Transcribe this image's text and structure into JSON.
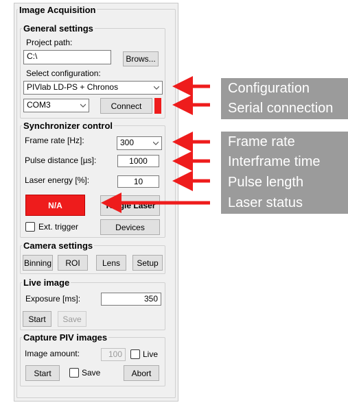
{
  "panel_title": "Image Acquisition",
  "general": {
    "title": "General settings",
    "project_path_label": "Project path:",
    "project_path_value": "C:\\",
    "browse_label": "Brows...",
    "select_config_label": "Select configuration:",
    "config_value": "PIVlab LD-PS + Chronos",
    "com_value": "COM3",
    "connect_label": "Connect"
  },
  "sync": {
    "title": "Synchronizer control",
    "frame_rate_label": "Frame rate [Hz]:",
    "frame_rate_value": "300",
    "pulse_distance_label": "Pulse distance [µs]:",
    "pulse_distance_value": "1000",
    "laser_energy_label": "Laser energy [%]:",
    "laser_energy_value": "10",
    "laser_status_value": "N/A",
    "toggle_laser_label": "Toggle Laser",
    "ext_trigger_label": "Ext. trigger",
    "devices_label": "Devices"
  },
  "camera": {
    "title": "Camera settings",
    "binning_label": "Binning",
    "roi_label": "ROI",
    "lens_label": "Lens",
    "setup_label": "Setup"
  },
  "live": {
    "title": "Live image",
    "exposure_label": "Exposure [ms]:",
    "exposure_value": "350",
    "start_label": "Start",
    "save_label": "Save"
  },
  "capture": {
    "title": "Capture PIV images",
    "image_amount_label": "Image amount:",
    "image_amount_value": "100",
    "live_label": "Live",
    "start_label": "Start",
    "save_label": "Save",
    "abort_label": "Abort"
  },
  "annotations": {
    "configuration": "Configuration",
    "serial_connection": "Serial connection",
    "frame_rate": "Frame rate",
    "interframe_time": "Interframe time",
    "pulse_length": "Pulse length",
    "laser_status": "Laser status"
  },
  "colors": {
    "arrow": "#ee1c1c",
    "annotation_bg": "#9b9b9b",
    "annotation_text": "#ffffff",
    "laser_status_bg": "#ee1c1c",
    "connect_indicator": "#ee1c1c"
  }
}
